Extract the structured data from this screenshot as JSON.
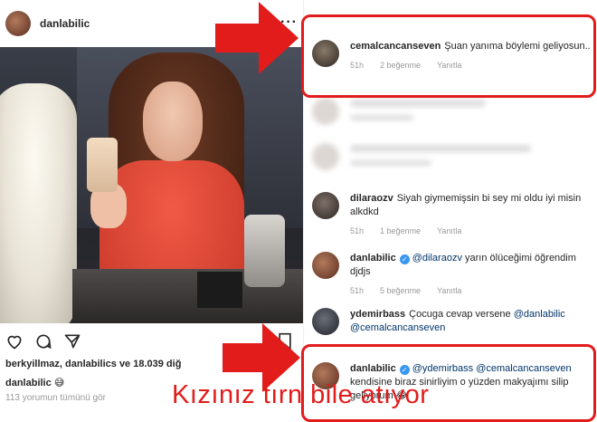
{
  "post": {
    "username": "danlabilic",
    "likes_text": "berkyillmaz, danlabilics ve 18.039 diğ",
    "caption_user": "danlabilic",
    "caption_emoji": "😅",
    "view_all": "113 yorumun tümünü gör"
  },
  "icons": {
    "more": "more-options-icon",
    "heart": "heart-icon",
    "comment": "comment-icon",
    "share": "share-icon",
    "bookmark": "bookmark-icon",
    "verified": "verified-badge-icon"
  },
  "comments": [
    {
      "user": "cemalcancanseven",
      "text": "Şuan yanıma böylemi geliyosun..",
      "time": "51h",
      "likes": "2 beğenme",
      "reply": "Yanıtla"
    },
    {
      "user": "dilaraozv",
      "text": "Siyah giymemişsin bi sey mi oldu iyi misin alkdkd",
      "time": "51h",
      "likes": "1 beğenme",
      "reply": "Yanıtla"
    },
    {
      "user": "danlabilic",
      "mention": "@dilaraozv",
      "text": " yarın ölüceğimi öğrendim djdjs",
      "time": "51h",
      "likes": "5 beğenme",
      "reply": "Yanıtla"
    },
    {
      "user": "ydemirbass",
      "text": "Çocuga cevap versene ",
      "mention1": "@danlabilic",
      "mention2": "@cemalcancanseven"
    },
    {
      "user": "danlabilic",
      "mention1": "@ydemirbass",
      "mention2": "@cemalcancanseven",
      "text": "kendisine biraz sinirliyim o yüzden makyajımı silip",
      "tail": "geliyorum 😂"
    }
  ],
  "overlay_caption": "Kızınız tırn bile atıyor",
  "colors": {
    "annotation_red": "#e21b1b",
    "verified_blue": "#3897f0",
    "link_blue": "#003569"
  }
}
